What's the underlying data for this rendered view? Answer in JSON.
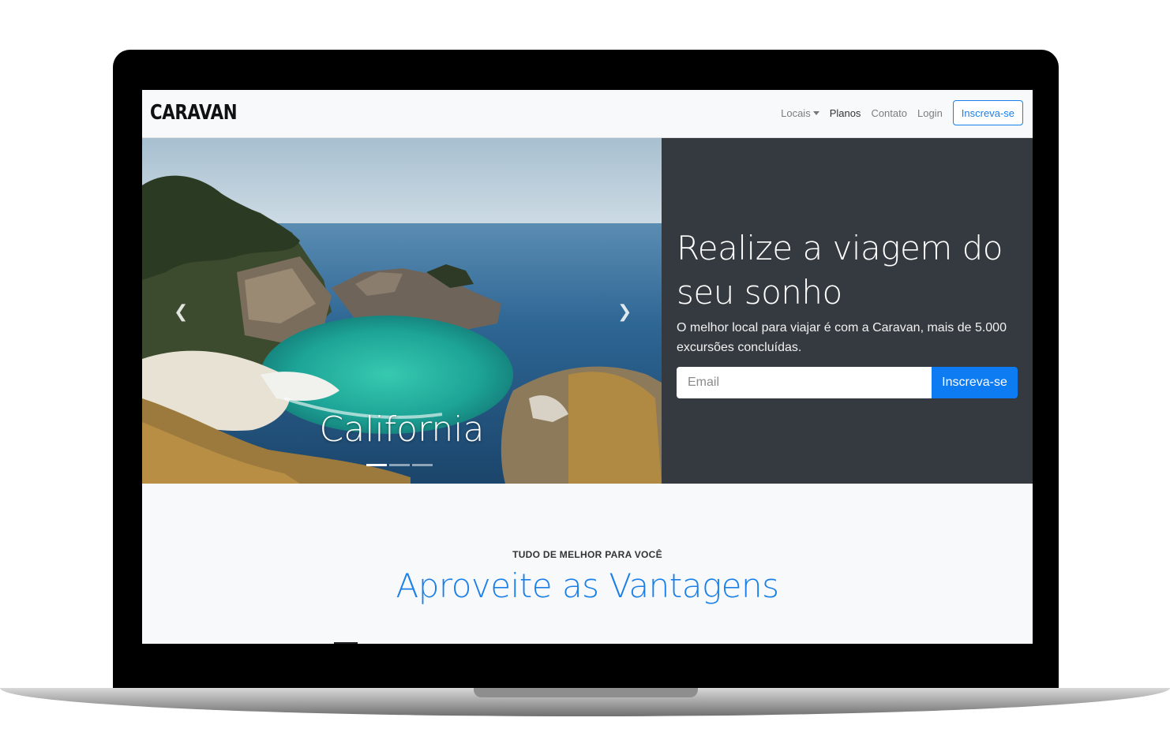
{
  "navbar": {
    "brand": "CARAVAN",
    "links": [
      {
        "label": "Locais",
        "has_dropdown": true
      },
      {
        "label": "Planos",
        "active": true
      },
      {
        "label": "Contato"
      },
      {
        "label": "Login"
      }
    ],
    "signup_button": "Inscreva-se"
  },
  "carousel": {
    "caption": "California",
    "slide_count": 3,
    "active_slide": 1,
    "prev_icon": "chevron-left-icon",
    "next_icon": "chevron-right-icon"
  },
  "hero": {
    "title": "Realize a viagem do seu sonho",
    "text": "O melhor local para viajar é com a Caravan, mais de 5.000 excursões concluídas.",
    "email_placeholder": "Email",
    "button": "Inscreva-se"
  },
  "advantages": {
    "eyebrow": "TUDO DE MELHOR PARA VOCÊ",
    "title": "Aproveite as Vantagens"
  },
  "colors": {
    "primary": "#1a7fe8",
    "button": "#0d7bf2",
    "panel": "#343a40",
    "navbar": "#f8f9fa"
  }
}
